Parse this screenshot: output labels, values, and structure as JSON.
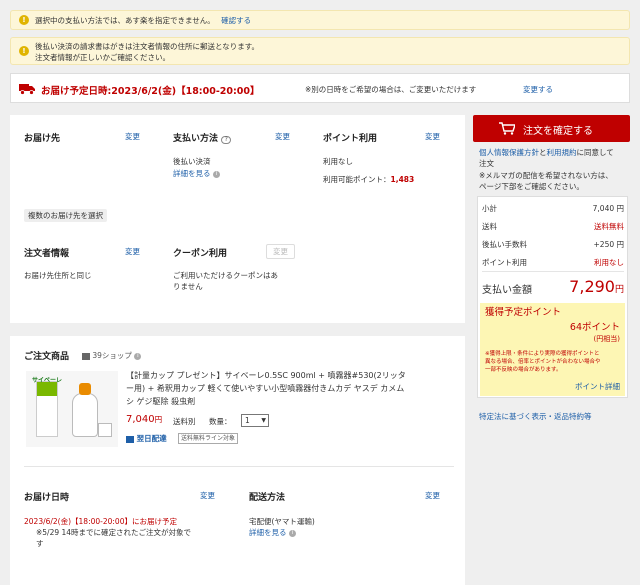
{
  "notices": {
    "n1": "選択中の支払い方法では、あす楽を指定できません。",
    "n1_link": "確認する",
    "n2_line1": "後払い決済の請求書はがきは注文者情報の住所に郵送となります。",
    "n2_line2": "注文者情報が正しいかご確認ください。"
  },
  "delivery_bar": {
    "date": "お届け予定日時:2023/6/2(金)【18:00-20:00】",
    "note": "※別の日時をご希望の場合は、ご変更いただけます",
    "change": "変更する"
  },
  "shipping": {
    "title": "お届け先",
    "change": "変更",
    "multi": "複数のお届け先を選択"
  },
  "payment": {
    "title": "支払い方法",
    "change": "変更",
    "method": "後払い決済",
    "details": "詳細を見る"
  },
  "points": {
    "title": "ポイント利用",
    "change": "変更",
    "usage": "利用なし",
    "available_label": "利用可能ポイント：",
    "available_value": "1,483"
  },
  "orderer": {
    "title": "注文者情報",
    "change": "変更",
    "same": "お届け先住所と同じ"
  },
  "coupon": {
    "title": "クーポン利用",
    "change": "変更",
    "line1": "ご利用いただけるクーポンはあ",
    "line2": "りません"
  },
  "order_items": {
    "title": "ご注文商品",
    "shop": "39ショップ",
    "product_line1": "【計量カップ プレゼント】サイベーレ0.5SC 900ml + 噴霧器#530(2リッタ",
    "product_line2": "ー用) + 希釈用カップ 軽くて使いやすい小型噴霧器付きムカデ ヤスデ カメム",
    "product_line3": "シ ゲジ駆除 殺虫剤",
    "price": "7,040",
    "yen": "円",
    "shipping_fee": "送料別",
    "qty_label": "数量：",
    "qty_value": "1",
    "next_day": "翌日配達",
    "free_ship_tag": "送料無料ライン対象",
    "product_img_label": "サイベーレ"
  },
  "delivery_date": {
    "title": "お届け日時",
    "change": "変更",
    "value": "2023/6/2(金)【18:00-20:00】にお届け予定",
    "note1": "※5/29 14時までに確定されたご注文が対象で",
    "note2": "す"
  },
  "delivery_method": {
    "title": "配送方法",
    "change": "変更",
    "value": "宅配便(ヤマト運輸)",
    "details": "詳細を見る"
  },
  "confirm": {
    "button": "注文を確定する",
    "terms_link1": "個人情報保護方針",
    "terms_and": "と",
    "terms_link2": "利用規約",
    "terms_rest": "に同意して",
    "terms_line2": "注文",
    "mail_line1": "※メルマガの配信を希望されない方は、",
    "mail_line2": "ページ下部をご確認ください。"
  },
  "summary": {
    "subtotal_label": "小計",
    "subtotal_value": "7,040 円",
    "shipping_label": "送料",
    "shipping_value": "送料無料",
    "fee_label": "後払い手数料",
    "fee_value": "+250 円",
    "points_label": "ポイント利用",
    "points_value": "利用なし",
    "total_label": "支払い金額",
    "total_value": "7,290",
    "total_yen": "円"
  },
  "earn_points": {
    "title": "獲得予定ポイント",
    "value": "64ポイント",
    "equiv": "(円相当)",
    "note1": "※獲得上限・条件により実際の獲得ポイントと",
    "note2": "異なる場合、倍率とポイントが合わない場合や",
    "note3": "一部不反映の場合があります。",
    "details": "ポイント詳細"
  },
  "legal_link": "特定法に基づく表示・返品特約等",
  "colors": {
    "accent": "#bf0000",
    "link": "#1e5fa8",
    "notice_bg": "#fdf6d8",
    "points_bg": "#fdf6b4"
  }
}
